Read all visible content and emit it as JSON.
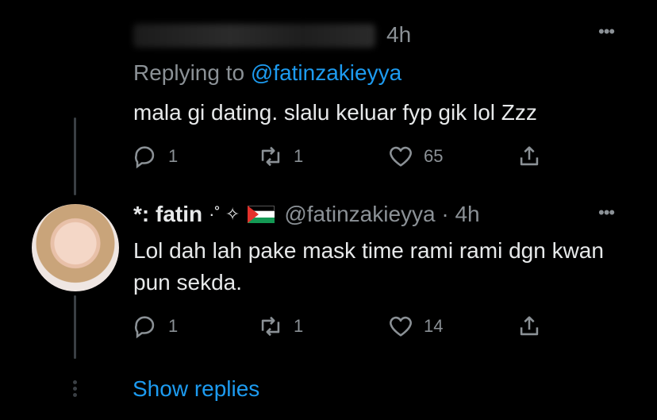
{
  "tweet1": {
    "time": "4h",
    "replying_prefix": "Replying to",
    "replying_handle": "@fatinzakieyya",
    "text": "mala gi dating. slalu keluar fyp gik lol Zzz",
    "replies": "1",
    "retweets": "1",
    "likes": "65"
  },
  "tweet2": {
    "name": "*: fatin",
    "decor": "·˚ ✧",
    "handle_time": "@fatinzakieyya · 4h",
    "text": "Lol dah lah pake mask time rami rami dgn kwan pun sekda.",
    "replies": "1",
    "retweets": "1",
    "likes": "14"
  },
  "more_label": "•••",
  "show_replies": "Show replies",
  "colors": {
    "background": "#000000",
    "text": "#e7e9ea",
    "muted": "#8b9196",
    "accent": "#1d9bf0"
  },
  "icons": [
    "reply-icon",
    "retweet-icon",
    "like-icon",
    "share-icon",
    "more-icon",
    "palestine-flag-icon"
  ]
}
